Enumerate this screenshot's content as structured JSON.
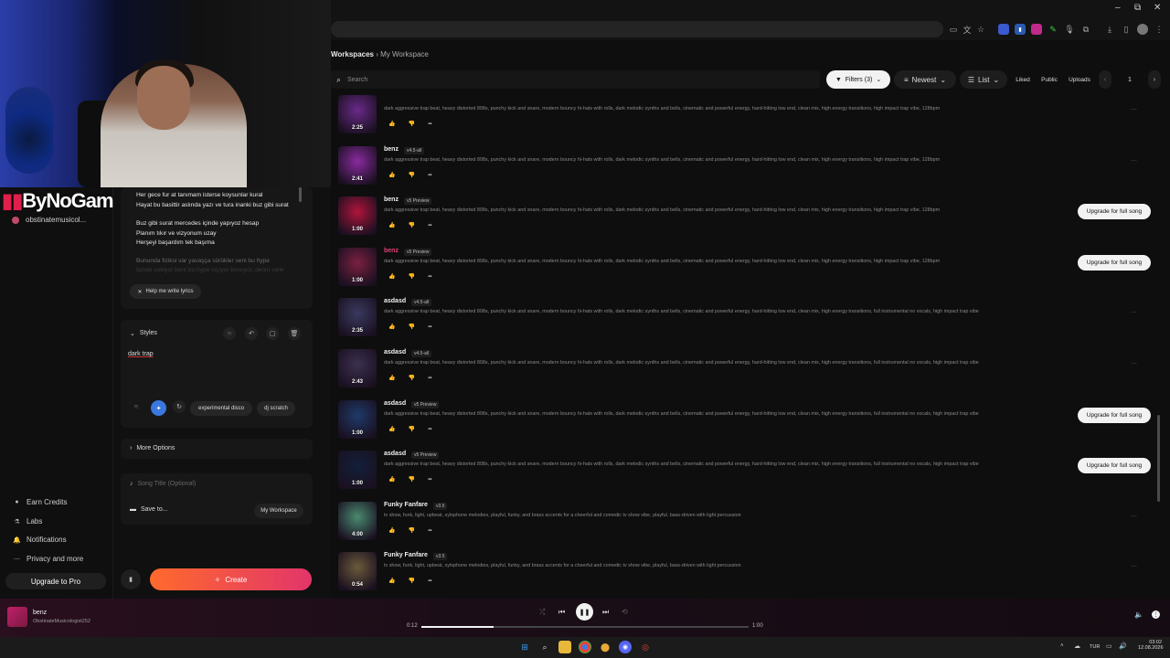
{
  "browser": {
    "minimize": "–",
    "maximize": "⧉",
    "close": "✕"
  },
  "webcam": {
    "brand": "ByNoGame",
    "brand_mark": "▮▮"
  },
  "sidebar": {
    "username": "obstinatemusicol...",
    "items": [
      {
        "label": "Earn Credits",
        "icon": "person-icon"
      },
      {
        "label": "Labs",
        "icon": "flask-icon"
      },
      {
        "label": "Notifications",
        "icon": "bell-icon"
      },
      {
        "label": "Privacy and more",
        "icon": "more-icon"
      }
    ],
    "upgrade": "Upgrade to Pro"
  },
  "create": {
    "lyrics": [
      "Her gece fur at tanımam isterse koysunlar kural",
      "Hayat bu basittir aslında yazı ve tura inanki buz gibi surat",
      "",
      "Buz gibi surat mercedes içinde yapıyoz hesap",
      "Planım tıkır ve vizyonum uzay",
      "Herşeyi başardım tek başıma"
    ],
    "lyrics_dim": [
      "Bununda fiziksi var yavaşça sürükler seni bu hype",
      "İçinde çekiyor bent bu hype sıçıyor bosuyor, denin sıkle"
    ],
    "help_button": "Help me write lyrics",
    "styles_label": "Styles",
    "styles_value": "dark trap",
    "style_tags": [
      "experimental disco",
      "dj scratch"
    ],
    "more_options": "More Options",
    "song_title_placeholder": "Song Title (Optional)",
    "save_to_label": "Save to...",
    "workspace": "My Workspace",
    "create_button": "Create"
  },
  "header": {
    "breadcrumb_root": "Workspaces",
    "breadcrumb_current": "My Workspace",
    "search_placeholder": "Search",
    "filters": "Filters (3)",
    "sort": "Newest",
    "view": "List",
    "liked": "Liked",
    "public": "Public",
    "uploads": "Uploads",
    "page": "1"
  },
  "songs": [
    {
      "title": "",
      "version": "",
      "duration": "2:25",
      "desc": "dark aggressive trap beat, heavy distorted 808s, punchy kick and snare, modern bouncy hi-hats with rolls, dark melodic synths and bells, cinematic and powerful energy, hard-hitting low end, clean mix, high energy transitions, high impact trap vibe, 128bpm",
      "upgrade": false,
      "color": "#6a2a8a",
      "title_color": "#f0f0f0"
    },
    {
      "title": "benz",
      "version": "v4.5-all",
      "duration": "2:41",
      "desc": "dark aggressive trap beat, heavy distorted 808s, punchy kick and snare, modern bouncy hi-hats with rolls, dark melodic synths and bells, cinematic and powerful energy, hard-hitting low end, clean mix, high energy transitions, high impact trap vibe, 128bpm",
      "upgrade": false,
      "color": "#8a2aa0",
      "title_color": "#f0f0f0"
    },
    {
      "title": "benz",
      "version": "v5 Preview",
      "duration": "1:00",
      "desc": "dark aggressive trap beat, heavy distorted 808s, punchy kick and snare, modern bouncy hi-hats with rolls, dark melodic synths and bells, cinematic and powerful energy, hard-hitting low end, clean mix, high energy transitions, high impact trap vibe, 128bpm",
      "upgrade": true,
      "color": "#b0143c",
      "title_color": "#f0f0f0"
    },
    {
      "title": "benz",
      "version": "v5 Preview",
      "duration": "1:00",
      "desc": "dark aggressive trap beat, heavy distorted 808s, punchy kick and snare, modern bouncy hi-hats with rolls, dark melodic synths and bells, cinematic and powerful energy, hard-hitting low end, clean mix, high energy transitions, high impact trap vibe, 128bpm",
      "upgrade": true,
      "color": "#7a2040",
      "title_color": "#e0407a"
    },
    {
      "title": "asdasd",
      "version": "v4.5-all",
      "duration": "2:35",
      "desc": "dark aggressive trap beat, heavy distorted 808s, punchy kick and snare, modern bouncy hi-hats with rolls, dark melodic synths and bells, cinematic and powerful energy, hard-hitting low end, clean mix, high energy transitions, full instrumental no vocals, high impact trap vibe",
      "upgrade": false,
      "color": "#3a3a60",
      "title_color": "#f0f0f0"
    },
    {
      "title": "asdasd",
      "version": "v4.5-all",
      "duration": "2:43",
      "desc": "dark aggressive trap beat, heavy distorted 808s, punchy kick and snare, modern bouncy hi-hats with rolls, dark melodic synths and bells, cinematic and powerful energy, hard-hitting low end, clean mix, high energy transitions, full instrumental no vocals, high impact trap vibe",
      "upgrade": false,
      "color": "#3c3050",
      "title_color": "#f0f0f0"
    },
    {
      "title": "asdasd",
      "version": "v5 Preview",
      "duration": "1:00",
      "desc": "dark aggressive trap beat, heavy distorted 808s, punchy kick and snare, modern bouncy hi-hats with rolls, dark melodic synths and bells, cinematic and powerful energy, hard-hitting low end, clean mix, high energy transitions, full instrumental no vocals, high impact trap vibe",
      "upgrade": true,
      "color": "#1e3a6a",
      "title_color": "#f0f0f0"
    },
    {
      "title": "asdasd",
      "version": "v5 Preview",
      "duration": "1:00",
      "desc": "dark aggressive trap beat, heavy distorted 808s, punchy kick and snare, modern bouncy hi-hats with rolls, dark melodic synths and bells, cinematic and powerful energy, hard-hitting low end, clean mix, high energy transitions, full instrumental no vocals, high impact trap vibe",
      "upgrade": true,
      "color": "#12203a",
      "title_color": "#f0f0f0"
    },
    {
      "title": "Funky Fanfare",
      "version": "v3.5",
      "duration": "4:00",
      "desc": "tv show, funk, light, upbeat, xylophone melodies, playful, funky, and brass accents for a cheerful and comedic tv show vibe, playful, bass-driven with light percussion",
      "upgrade": false,
      "color": "#4a8a70",
      "title_color": "#f0f0f0"
    },
    {
      "title": "Funky Fanfare",
      "version": "v3.5",
      "duration": "0:54",
      "desc": "tv show, funk, light, upbeat, xylophone melodies, playful, funky, and brass accents for a cheerful and comedic tv show vibe, playful, bass-driven with light percussion",
      "upgrade": false,
      "color": "#6a5a3a",
      "title_color": "#f0f0f0"
    }
  ],
  "upgrade_label": "Upgrade for full song",
  "player": {
    "title": "benz",
    "artist": "ObstinateMusicologist252",
    "elapsed": "0:12",
    "total": "1:00",
    "progress": 0.22
  },
  "taskbar": {
    "lang": "TUR",
    "time": "03:02",
    "date": "12.08.2026"
  }
}
